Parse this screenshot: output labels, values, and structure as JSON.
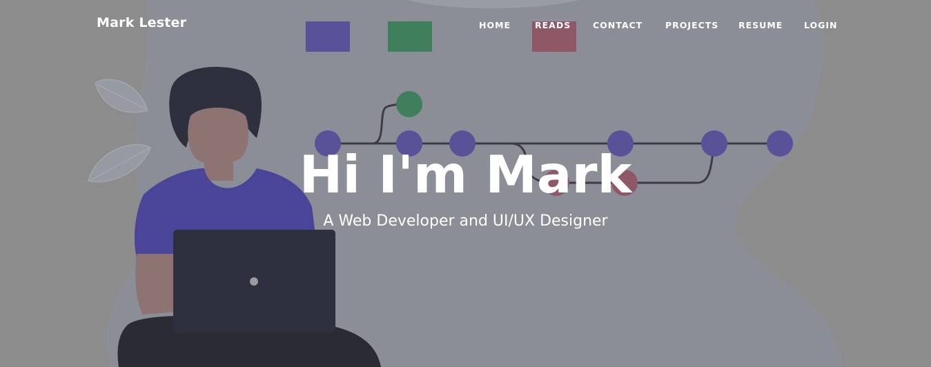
{
  "header": {
    "brand": "Mark Lester",
    "nav": [
      {
        "label": "HOME"
      },
      {
        "label": "READS"
      },
      {
        "label": "CONTACT"
      },
      {
        "label": "PROJECTS"
      },
      {
        "label": "RESUME"
      },
      {
        "label": "LOGIN"
      }
    ]
  },
  "hero": {
    "title": "Hi I'm Mark",
    "subtitle": "A Web Developer and UI/UX Designer"
  },
  "colors": {
    "page_background": "#8c8c8c",
    "blob": "#8b8e97",
    "indigo": "#5a5298",
    "green": "#3f7f5b",
    "rose": "#8f5866",
    "text": "#ffffff"
  }
}
